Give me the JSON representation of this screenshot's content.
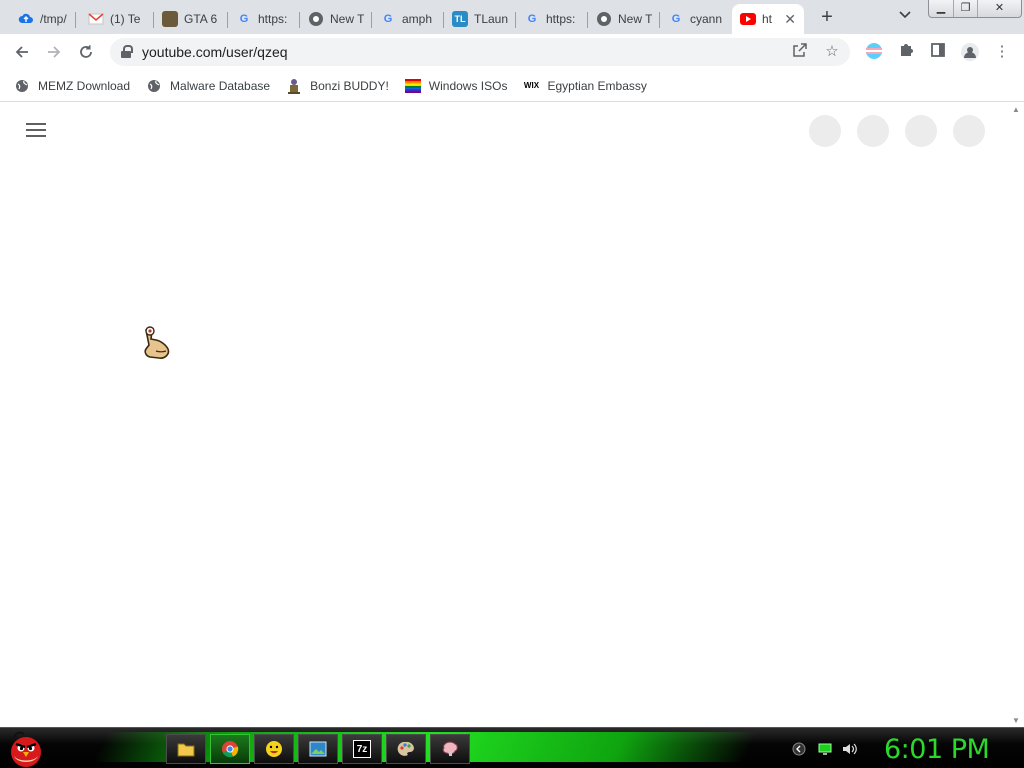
{
  "colors": {
    "tab_strip_bg": "#dee1e6",
    "omnibox_bg": "#f1f3f4",
    "youtube_red": "#ff0000",
    "taskbar_accent": "#22e022",
    "clock_color": "#2bd92b"
  },
  "tabs": [
    {
      "title": "/tmp/",
      "icon": "cloud-upload-icon",
      "color": "#1a73e8"
    },
    {
      "title": "(1) Te",
      "icon": "gmail-icon",
      "color": "#ea4335"
    },
    {
      "title": "GTA 6",
      "icon": "game-thumbnail-icon",
      "color": "#6b5b3a"
    },
    {
      "title": "https:",
      "icon": "google-icon",
      "color": "#4285f4"
    },
    {
      "title": "New T",
      "icon": "chrome-icon",
      "color": "#5f6368"
    },
    {
      "title": "amph",
      "icon": "google-icon",
      "color": "#4285f4"
    },
    {
      "title": "TLaun",
      "icon": "tlauncher-icon",
      "color": "#2a8cc7"
    },
    {
      "title": "https:",
      "icon": "google-icon",
      "color": "#4285f4"
    },
    {
      "title": "New T",
      "icon": "chrome-icon",
      "color": "#5f6368"
    },
    {
      "title": "cyann",
      "icon": "google-icon",
      "color": "#4285f4"
    },
    {
      "title": "ht",
      "icon": "youtube-icon",
      "color": "#ff0000"
    }
  ],
  "address_bar": {
    "url": "youtube.com/user/qzeq"
  },
  "bookmarks": [
    {
      "label": "MEMZ Download",
      "icon": "globe-icon"
    },
    {
      "label": "Malware Database",
      "icon": "globe-icon"
    },
    {
      "label": "Bonzi BUDDY!",
      "icon": "bonzi-icon"
    },
    {
      "label": "Windows ISOs",
      "icon": "rainbow-flag-icon"
    },
    {
      "label": "Egyptian Embassy",
      "icon": "wix-icon"
    }
  ],
  "taskbar": {
    "items": [
      "folder-icon",
      "chrome-icon",
      "emoji-icon",
      "image-viewer-icon",
      "7zip-icon",
      "paint-icon",
      "brain-icon"
    ],
    "active_index": 1,
    "clock": "6:01 PM"
  },
  "glyphs": {
    "tlauncher": "TL",
    "wix": "WIX",
    "sevenzip": "7z"
  }
}
